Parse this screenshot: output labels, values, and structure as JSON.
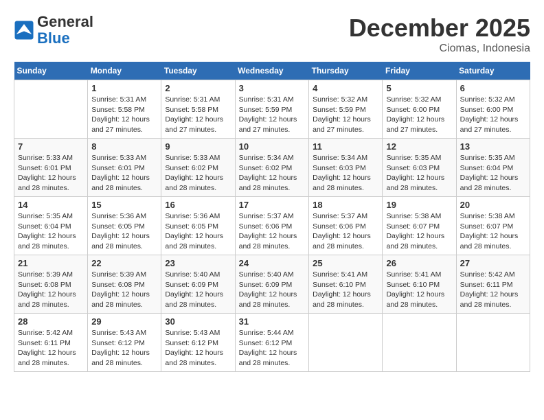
{
  "header": {
    "logo_line1": "General",
    "logo_line2": "Blue",
    "month": "December 2025",
    "location": "Ciomas, Indonesia"
  },
  "weekdays": [
    "Sunday",
    "Monday",
    "Tuesday",
    "Wednesday",
    "Thursday",
    "Friday",
    "Saturday"
  ],
  "weeks": [
    [
      {
        "day": "",
        "info": ""
      },
      {
        "day": "1",
        "info": "Sunrise: 5:31 AM\nSunset: 5:58 PM\nDaylight: 12 hours\nand 27 minutes."
      },
      {
        "day": "2",
        "info": "Sunrise: 5:31 AM\nSunset: 5:58 PM\nDaylight: 12 hours\nand 27 minutes."
      },
      {
        "day": "3",
        "info": "Sunrise: 5:31 AM\nSunset: 5:59 PM\nDaylight: 12 hours\nand 27 minutes."
      },
      {
        "day": "4",
        "info": "Sunrise: 5:32 AM\nSunset: 5:59 PM\nDaylight: 12 hours\nand 27 minutes."
      },
      {
        "day": "5",
        "info": "Sunrise: 5:32 AM\nSunset: 6:00 PM\nDaylight: 12 hours\nand 27 minutes."
      },
      {
        "day": "6",
        "info": "Sunrise: 5:32 AM\nSunset: 6:00 PM\nDaylight: 12 hours\nand 27 minutes."
      }
    ],
    [
      {
        "day": "7",
        "info": "Sunrise: 5:33 AM\nSunset: 6:01 PM\nDaylight: 12 hours\nand 28 minutes."
      },
      {
        "day": "8",
        "info": "Sunrise: 5:33 AM\nSunset: 6:01 PM\nDaylight: 12 hours\nand 28 minutes."
      },
      {
        "day": "9",
        "info": "Sunrise: 5:33 AM\nSunset: 6:02 PM\nDaylight: 12 hours\nand 28 minutes."
      },
      {
        "day": "10",
        "info": "Sunrise: 5:34 AM\nSunset: 6:02 PM\nDaylight: 12 hours\nand 28 minutes."
      },
      {
        "day": "11",
        "info": "Sunrise: 5:34 AM\nSunset: 6:03 PM\nDaylight: 12 hours\nand 28 minutes."
      },
      {
        "day": "12",
        "info": "Sunrise: 5:35 AM\nSunset: 6:03 PM\nDaylight: 12 hours\nand 28 minutes."
      },
      {
        "day": "13",
        "info": "Sunrise: 5:35 AM\nSunset: 6:04 PM\nDaylight: 12 hours\nand 28 minutes."
      }
    ],
    [
      {
        "day": "14",
        "info": "Sunrise: 5:35 AM\nSunset: 6:04 PM\nDaylight: 12 hours\nand 28 minutes."
      },
      {
        "day": "15",
        "info": "Sunrise: 5:36 AM\nSunset: 6:05 PM\nDaylight: 12 hours\nand 28 minutes."
      },
      {
        "day": "16",
        "info": "Sunrise: 5:36 AM\nSunset: 6:05 PM\nDaylight: 12 hours\nand 28 minutes."
      },
      {
        "day": "17",
        "info": "Sunrise: 5:37 AM\nSunset: 6:06 PM\nDaylight: 12 hours\nand 28 minutes."
      },
      {
        "day": "18",
        "info": "Sunrise: 5:37 AM\nSunset: 6:06 PM\nDaylight: 12 hours\nand 28 minutes."
      },
      {
        "day": "19",
        "info": "Sunrise: 5:38 AM\nSunset: 6:07 PM\nDaylight: 12 hours\nand 28 minutes."
      },
      {
        "day": "20",
        "info": "Sunrise: 5:38 AM\nSunset: 6:07 PM\nDaylight: 12 hours\nand 28 minutes."
      }
    ],
    [
      {
        "day": "21",
        "info": "Sunrise: 5:39 AM\nSunset: 6:08 PM\nDaylight: 12 hours\nand 28 minutes."
      },
      {
        "day": "22",
        "info": "Sunrise: 5:39 AM\nSunset: 6:08 PM\nDaylight: 12 hours\nand 28 minutes."
      },
      {
        "day": "23",
        "info": "Sunrise: 5:40 AM\nSunset: 6:09 PM\nDaylight: 12 hours\nand 28 minutes."
      },
      {
        "day": "24",
        "info": "Sunrise: 5:40 AM\nSunset: 6:09 PM\nDaylight: 12 hours\nand 28 minutes."
      },
      {
        "day": "25",
        "info": "Sunrise: 5:41 AM\nSunset: 6:10 PM\nDaylight: 12 hours\nand 28 minutes."
      },
      {
        "day": "26",
        "info": "Sunrise: 5:41 AM\nSunset: 6:10 PM\nDaylight: 12 hours\nand 28 minutes."
      },
      {
        "day": "27",
        "info": "Sunrise: 5:42 AM\nSunset: 6:11 PM\nDaylight: 12 hours\nand 28 minutes."
      }
    ],
    [
      {
        "day": "28",
        "info": "Sunrise: 5:42 AM\nSunset: 6:11 PM\nDaylight: 12 hours\nand 28 minutes."
      },
      {
        "day": "29",
        "info": "Sunrise: 5:43 AM\nSunset: 6:12 PM\nDaylight: 12 hours\nand 28 minutes."
      },
      {
        "day": "30",
        "info": "Sunrise: 5:43 AM\nSunset: 6:12 PM\nDaylight: 12 hours\nand 28 minutes."
      },
      {
        "day": "31",
        "info": "Sunrise: 5:44 AM\nSunset: 6:12 PM\nDaylight: 12 hours\nand 28 minutes."
      },
      {
        "day": "",
        "info": ""
      },
      {
        "day": "",
        "info": ""
      },
      {
        "day": "",
        "info": ""
      }
    ]
  ]
}
